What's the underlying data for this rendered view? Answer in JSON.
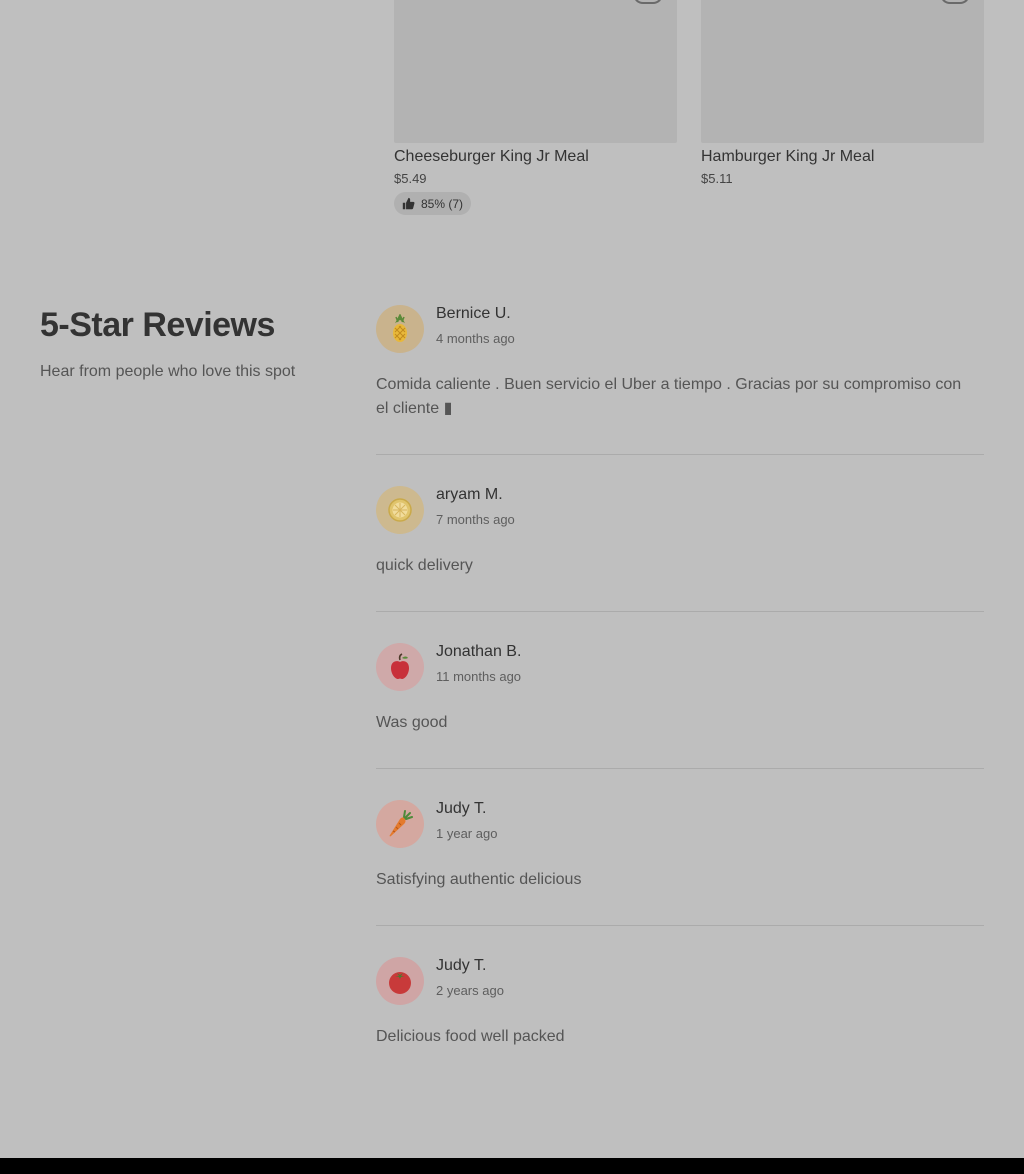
{
  "products": [
    {
      "name": "Cheeseburger King Jr Meal",
      "price": "$5.49",
      "rating": "85% (7)"
    },
    {
      "name": "Hamburger King Jr Meal",
      "price": "$5.11"
    }
  ],
  "reviews_section": {
    "title": "5-Star Reviews",
    "subtitle": "Hear from people who love this spot"
  },
  "reviews": [
    {
      "name": "Bernice U.",
      "date": "4 months ago",
      "text": "Comida caliente . Buen servicio el Uber a tiempo . Gracias por su compromiso con el cliente ▮",
      "avatar_icon": "pineapple-icon",
      "avatar_color": "#c9b38d"
    },
    {
      "name": "aryam M.",
      "date": "7 months ago",
      "text": "quick delivery",
      "avatar_icon": "lemon-icon",
      "avatar_color": "#cdb98f"
    },
    {
      "name": "Jonathan B.",
      "date": "11 months ago",
      "text": "Was good",
      "avatar_icon": "apple-icon",
      "avatar_color": "#cfa9a9"
    },
    {
      "name": "Judy T.",
      "date": "1 year ago",
      "text": "Satisfying authentic delicious",
      "avatar_icon": "carrot-icon",
      "avatar_color": "#d4a8a0"
    },
    {
      "name": "Judy T.",
      "date": "2 years ago",
      "text": "Delicious food well packed",
      "avatar_icon": "tomato-icon",
      "avatar_color": "#cfa5a5"
    }
  ]
}
